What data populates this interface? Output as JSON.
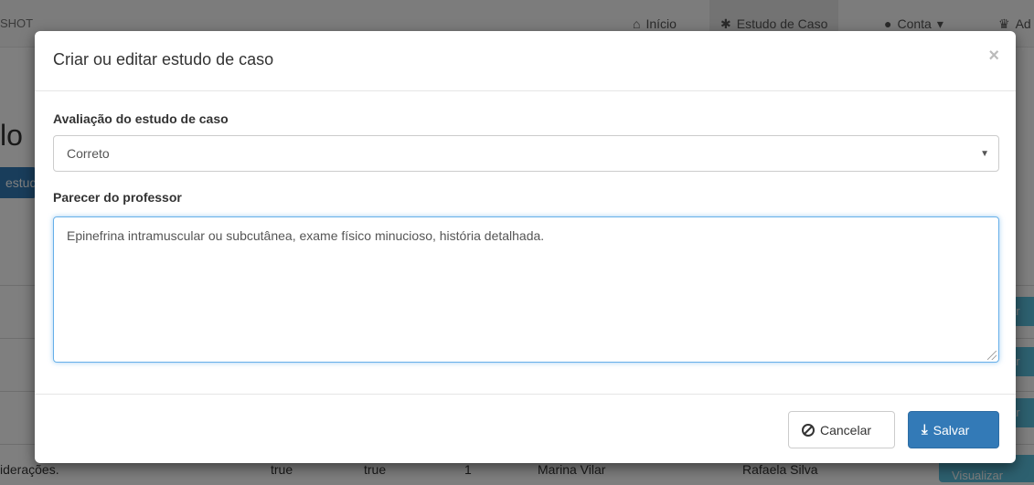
{
  "background": {
    "brand": "SHOT",
    "nav": {
      "home": "Início",
      "case_study": "Estudo de Caso",
      "account": "Conta",
      "admin": "Ad"
    },
    "page_heading_fragment": "lo",
    "primary_button_fragment": "estud",
    "row_button_fragment": "ar",
    "last_row": {
      "col1": "iderações.",
      "col2": "true",
      "col3": "true",
      "col4": "1",
      "col5": "Marina Vilar",
      "col6": "Rafaela Silva",
      "action": "Visualizar"
    }
  },
  "modal": {
    "title": "Criar ou editar estudo de caso",
    "close_symbol": "×",
    "evaluation_label": "Avaliação do estudo de caso",
    "evaluation_value": "Correto",
    "opinion_label": "Parecer do professor",
    "opinion_value": "Epinefrina intramuscular ou subcutânea, exame físico minucioso, história detalhada.",
    "cancel_label": "Cancelar",
    "save_label": "Salvar"
  },
  "colors": {
    "primary": "#337ab7",
    "info": "#5bc0de",
    "focus_border": "#66afe9"
  }
}
